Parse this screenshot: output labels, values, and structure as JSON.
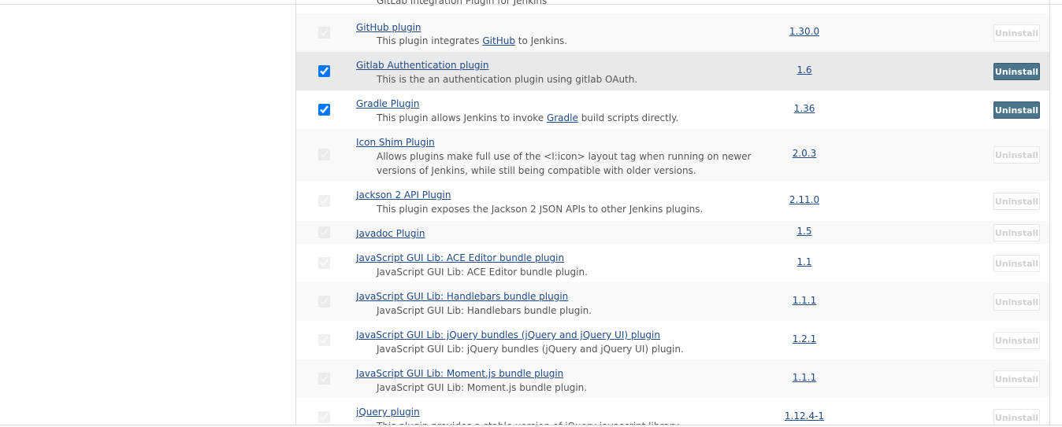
{
  "partial_top_text": "GitLab Integration Plugin for Jenkins",
  "uninstall_label": "Uninstall",
  "colors": {
    "link": "#204a87",
    "button_active": "#4b758b",
    "row_highlight": "#e9e9e9"
  },
  "plugins": [
    {
      "name": "GitHub plugin",
      "desc_before": "This plugin integrates ",
      "desc_link": "GitHub",
      "desc_after": " to Jenkins.",
      "version": "1.30.0",
      "checked": true,
      "enabled": false
    },
    {
      "name": "Gitlab Authentication plugin",
      "desc_before": "This is the an authentication plugin using gitlab OAuth.",
      "desc_link": "",
      "desc_after": "",
      "version": "1.6",
      "checked": true,
      "enabled": true
    },
    {
      "name": "Gradle Plugin",
      "desc_before": "This plugin allows Jenkins to invoke ",
      "desc_link": "Gradle",
      "desc_after": " build scripts directly.",
      "version": "1.36",
      "checked": true,
      "enabled": true
    },
    {
      "name": "Icon Shim Plugin",
      "desc_before": "Allows plugins make full use of the <l:icon> layout tag when running on newer versions of Jenkins, while still being compatible with older versions.",
      "desc_link": "",
      "desc_after": "",
      "version": "2.0.3",
      "checked": true,
      "enabled": false
    },
    {
      "name": "Jackson 2 API Plugin",
      "desc_before": "This plugin exposes the Jackson 2 JSON APIs to other Jenkins plugins.",
      "desc_link": "",
      "desc_after": "",
      "version": "2.11.0",
      "checked": true,
      "enabled": false
    },
    {
      "name": "Javadoc Plugin",
      "desc_before": "",
      "desc_link": "",
      "desc_after": "",
      "version": "1.5",
      "checked": true,
      "enabled": false
    },
    {
      "name": "JavaScript GUI Lib: ACE Editor bundle plugin",
      "desc_before": "JavaScript GUI Lib: ACE Editor bundle plugin.",
      "desc_link": "",
      "desc_after": "",
      "version": "1.1",
      "checked": true,
      "enabled": false
    },
    {
      "name": "JavaScript GUI Lib: Handlebars bundle plugin",
      "desc_before": "JavaScript GUI Lib: Handlebars bundle plugin.",
      "desc_link": "",
      "desc_after": "",
      "version": "1.1.1",
      "checked": true,
      "enabled": false
    },
    {
      "name": "JavaScript GUI Lib: jQuery bundles (jQuery and jQuery UI) plugin",
      "desc_before": "JavaScript GUI Lib: jQuery bundles (jQuery and jQuery UI) plugin.",
      "desc_link": "",
      "desc_after": "",
      "version": "1.2.1",
      "checked": true,
      "enabled": false
    },
    {
      "name": "JavaScript GUI Lib: Moment.js bundle plugin",
      "desc_before": "JavaScript GUI Lib: Moment.js bundle plugin.",
      "desc_link": "",
      "desc_after": "",
      "version": "1.1.1",
      "checked": true,
      "enabled": false
    },
    {
      "name": "jQuery plugin",
      "desc_before": "This plugin provides a stable version of jQuery javascript library.",
      "desc_link": "",
      "desc_after": "",
      "version": "1.12.4-1",
      "checked": true,
      "enabled": false
    }
  ]
}
